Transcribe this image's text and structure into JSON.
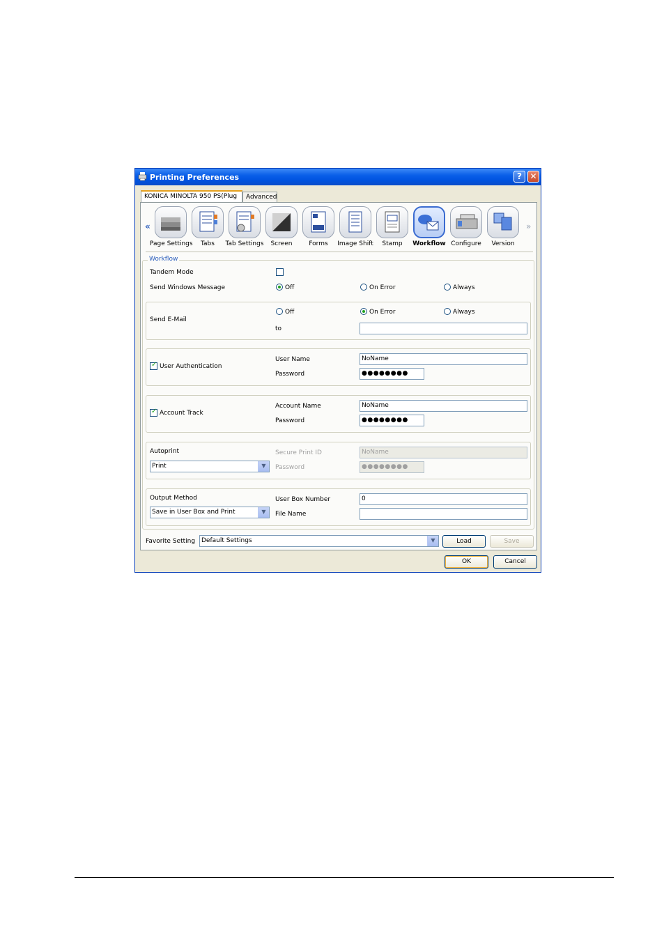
{
  "window": {
    "title": "Printing Preferences",
    "help_glyph": "?",
    "close_glyph": "✕"
  },
  "tabs": [
    {
      "label": "KONICA MINOLTA 950 PS(Plug"
    },
    {
      "label": "Advanced"
    }
  ],
  "icon_strip": {
    "prev_glyph": "«",
    "next_glyph": "»",
    "items": [
      {
        "label": "Page Settings",
        "icon": "page-settings-icon"
      },
      {
        "label": "Tabs",
        "icon": "tabs-icon"
      },
      {
        "label": "Tab Settings",
        "icon": "tab-settings-icon"
      },
      {
        "label": "Screen",
        "icon": "screen-icon"
      },
      {
        "label": "Forms",
        "icon": "forms-icon"
      },
      {
        "label": "Image Shift",
        "icon": "image-shift-icon"
      },
      {
        "label": "Stamp",
        "icon": "stamp-icon"
      },
      {
        "label": "Workflow",
        "icon": "workflow-icon",
        "selected": true
      },
      {
        "label": "Configure",
        "icon": "configure-icon"
      },
      {
        "label": "Version",
        "icon": "version-icon"
      }
    ]
  },
  "workflow": {
    "heading": "Workflow",
    "tandem_mode": {
      "label": "Tandem Mode",
      "checked": false
    },
    "send_windows_message": {
      "label": "Send Windows Message",
      "options": [
        "Off",
        "On Error",
        "Always"
      ],
      "selected": "Off"
    },
    "send_email": {
      "label": "Send E-Mail",
      "options": [
        "Off",
        "On Error",
        "Always"
      ],
      "selected": "On Error",
      "to_label": "to",
      "to_value": ""
    },
    "user_auth": {
      "label": "User Authentication",
      "checked": true,
      "user_name_label": "User Name",
      "user_name_value": "NoName",
      "password_label": "Password",
      "password_value": "●●●●●●●●"
    },
    "account_track": {
      "label": "Account Track",
      "checked": true,
      "account_name_label": "Account Name",
      "account_name_value": "NoName",
      "password_label": "Password",
      "password_value": "●●●●●●●●"
    },
    "autoprint": {
      "label": "Autoprint",
      "selected": "Print",
      "secure_print_id_label": "Secure Print ID",
      "secure_print_id_value": "NoName",
      "password_label": "Password",
      "password_value": "●●●●●●●●"
    },
    "output_method": {
      "label": "Output Method",
      "selected": "Save in User Box and Print",
      "user_box_number_label": "User Box Number",
      "user_box_number_value": "0",
      "file_name_label": "File Name",
      "file_name_value": ""
    }
  },
  "favorite": {
    "label": "Favorite Setting",
    "selected": "Default Settings",
    "load_label": "Load",
    "save_label": "Save"
  },
  "footer": {
    "ok_label": "OK",
    "cancel_label": "Cancel"
  },
  "dropdown_glyph": "▼",
  "colors": {
    "title_bar": "#0a5fe8",
    "accent_green": "#21a121",
    "panel_bg": "#ece9d8",
    "group_heading": "#2b5ebc"
  }
}
